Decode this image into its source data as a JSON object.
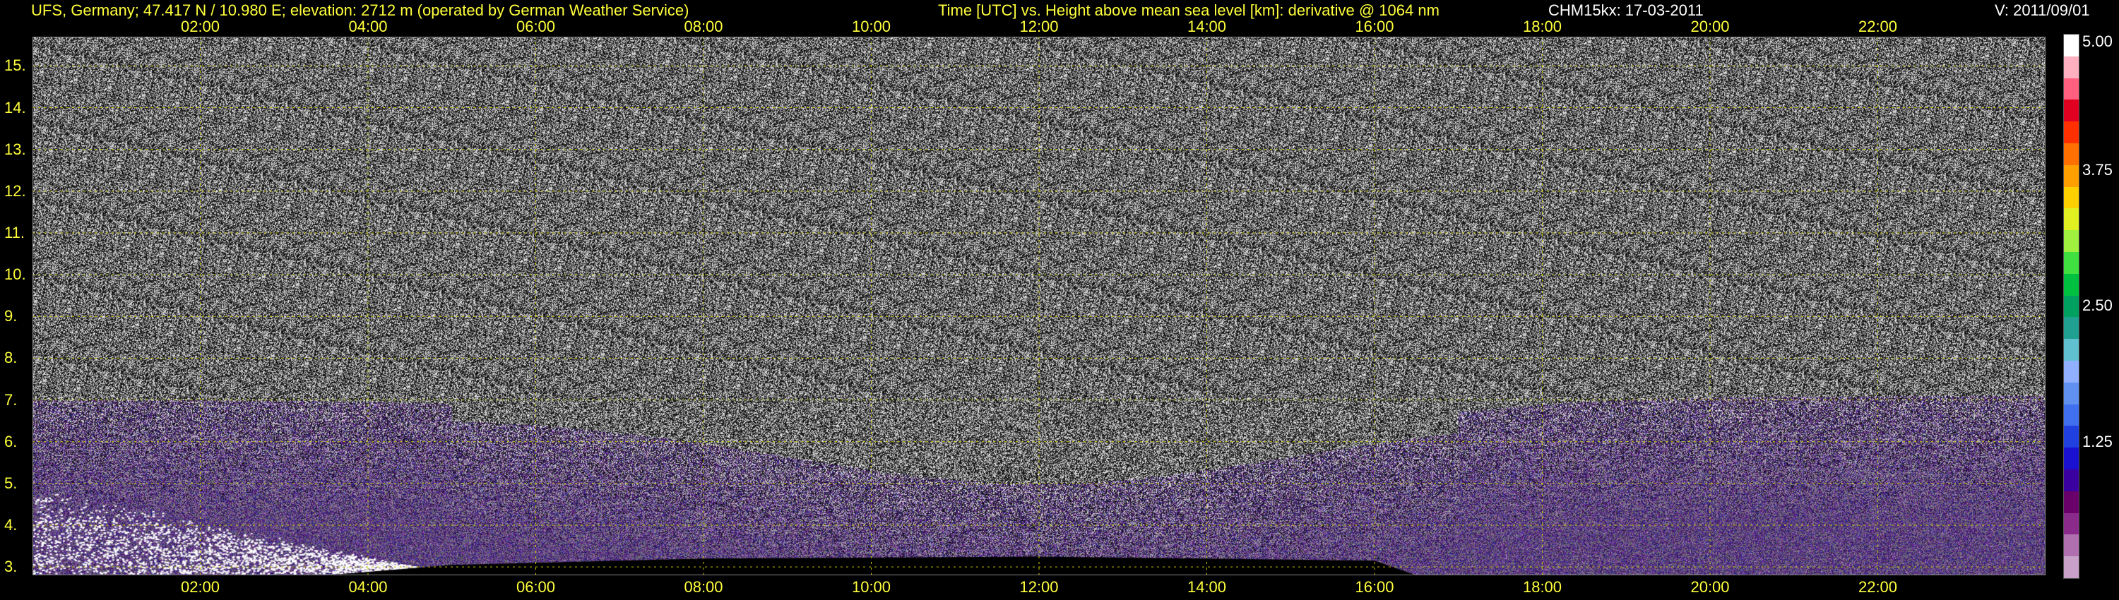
{
  "header": {
    "station": "UFS, Germany; 47.417 N / 10.980 E; elevation: 2712 m  (operated by German Weather Service)",
    "axes_title": "Time [UTC] vs. Height above mean sea level [km]: derivative @ 1064 nm",
    "instrument_date": "CHM15kx: 17-03-2011",
    "version": "V: 2011/09/01"
  },
  "chart_data": {
    "type": "heatmap",
    "title": "Time [UTC] vs. Height above mean sea level [km]: derivative @ 1064 nm",
    "xlabel": "Time [UTC]",
    "ylabel": "Height above mean sea level [km]",
    "x_range_hours": [
      0,
      24
    ],
    "y_range_km": [
      2.8,
      15.7
    ],
    "x_ticks": [
      "02:00",
      "04:00",
      "06:00",
      "08:00",
      "10:00",
      "12:00",
      "14:00",
      "16:00",
      "18:00",
      "20:00",
      "22:00"
    ],
    "x_tick_hours": [
      2,
      4,
      6,
      8,
      10,
      12,
      14,
      16,
      18,
      20,
      22
    ],
    "y_ticks": [
      "3.",
      "4.",
      "5.",
      "6.",
      "7.",
      "8.",
      "9.",
      "10.",
      "11.",
      "12.",
      "13.",
      "14.",
      "15."
    ],
    "y_tick_values": [
      3,
      4,
      5,
      6,
      7,
      8,
      9,
      10,
      11,
      12,
      13,
      14,
      15
    ],
    "colorbar": {
      "ticks": [
        "5.00",
        "3.75",
        "2.50",
        "1.25"
      ],
      "tick_values": [
        5.0,
        3.75,
        2.5,
        1.25
      ],
      "range": [
        0,
        5.0
      ],
      "colors": [
        "#c8a0c8",
        "#b070b0",
        "#8a2a8a",
        "#6a006a",
        "#3a00a0",
        "#1a10d0",
        "#2040e0",
        "#4070f0",
        "#6090f0",
        "#90b0ff",
        "#60c0d0",
        "#20a090",
        "#00a060",
        "#00c040",
        "#40e040",
        "#a0f040",
        "#e0f020",
        "#ffd000",
        "#ffa000",
        "#ff7000",
        "#ff3000",
        "#e00020",
        "#ff6080",
        "#ffb0c0",
        "#ffffff"
      ]
    },
    "grid": true,
    "regions": [
      {
        "feature": "boundary layer (purple/blue)",
        "x_hours": [
          0,
          24
        ],
        "top_km": 7.0
      },
      {
        "feature": "cloud (white)",
        "x_hours": [
          0,
          4.5
        ],
        "top_km": 5.0
      },
      {
        "feature": "ground layer (black)",
        "x_hours": [
          5,
          16
        ],
        "height_km": 3.2
      }
    ]
  }
}
